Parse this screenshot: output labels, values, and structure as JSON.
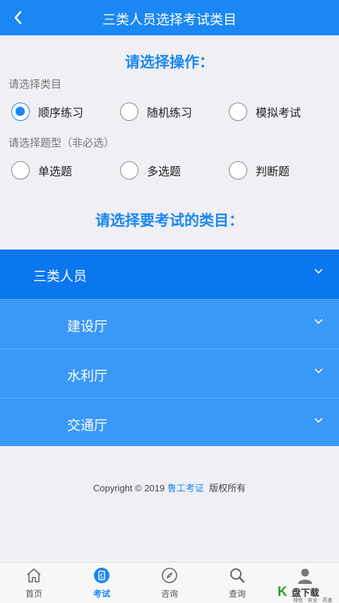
{
  "header": {
    "title": "三类人员选择考试类目"
  },
  "operation": {
    "title": "请选择操作：",
    "category_label": "请选择类目",
    "category_options": [
      {
        "label": "顺序练习",
        "checked": true
      },
      {
        "label": "随机练习",
        "checked": false
      },
      {
        "label": "模拟考试",
        "checked": false
      }
    ],
    "type_label": "请选择题型（非必选）",
    "type_options": [
      {
        "label": "单选题",
        "checked": false
      },
      {
        "label": "多选题",
        "checked": false
      },
      {
        "label": "判断题",
        "checked": false
      }
    ]
  },
  "exam": {
    "title": "请选择要考试的类目：",
    "top_category": "三类人员",
    "sub_categories": [
      "建设厅",
      "水利厅",
      "交通厅"
    ]
  },
  "footer": {
    "copyright_prefix": "Copyright © 2019 ",
    "brand": "鲁工考证",
    "copyright_suffix": "  版权所有"
  },
  "tabbar": {
    "tabs": [
      {
        "label": "首页",
        "icon": "home-icon",
        "active": false
      },
      {
        "label": "考试",
        "icon": "exam-icon",
        "active": true
      },
      {
        "label": "咨询",
        "icon": "compass-icon",
        "active": false
      },
      {
        "label": "查询",
        "icon": "search-icon",
        "active": false
      },
      {
        "label": "",
        "icon": "user-icon",
        "active": false
      }
    ]
  },
  "watermark": {
    "text": "盘下载",
    "subtext": "绿色 · 安全 · 高速"
  },
  "colors": {
    "primary": "#1a87f3",
    "category_top": "#0a77ee",
    "category_sub": "#3a98f6"
  }
}
